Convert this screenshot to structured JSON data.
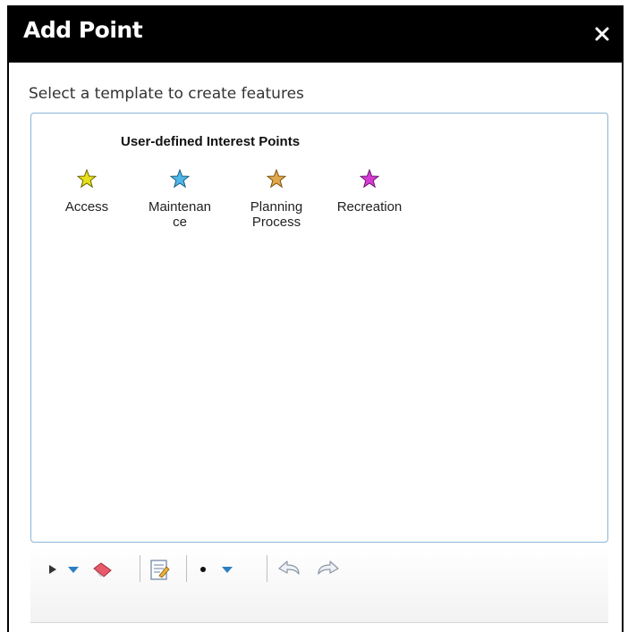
{
  "dialog": {
    "title": "Add Point",
    "close_icon": "close-icon"
  },
  "prompt": "Select a template to create features",
  "template_group": {
    "title": "User-defined Interest Points",
    "templates": [
      {
        "label": "Access",
        "icon": "star-icon",
        "color": "#e8e01a"
      },
      {
        "label": "Maintenance",
        "icon": "star-icon",
        "color": "#4fb6e8"
      },
      {
        "label": "Planning Process",
        "icon": "star-icon",
        "color": "#e0a84a"
      },
      {
        "label": "Recreation",
        "icon": "star-icon",
        "color": "#d63ad6"
      }
    ]
  },
  "toolbar": {
    "tools": [
      {
        "name": "select-arrow-icon"
      },
      {
        "name": "dropdown-arrow-icon"
      },
      {
        "name": "eraser-icon"
      },
      {
        "name": "attributes-icon"
      },
      {
        "name": "point-icon"
      },
      {
        "name": "dropdown-arrow-icon"
      },
      {
        "name": "undo-icon"
      },
      {
        "name": "redo-icon"
      }
    ]
  },
  "colors": {
    "title_bar": "#000000",
    "panel_border": "#8bb5d8",
    "dropdown_arrow": "#2c7fc4"
  }
}
